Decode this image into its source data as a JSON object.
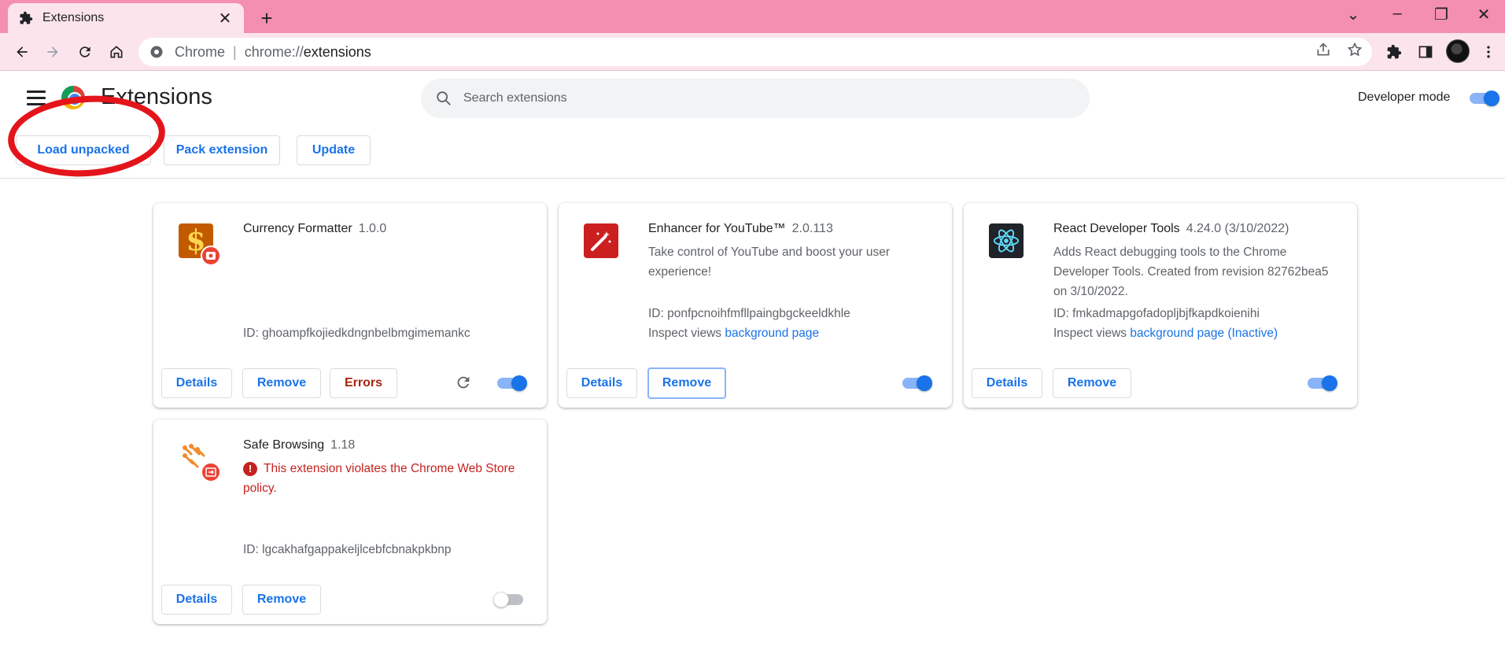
{
  "browser": {
    "tab_title": "Extensions",
    "omnibox": {
      "chip": "Chrome",
      "separator": "|",
      "url_scheme": "chrome://",
      "url_path": "extensions"
    }
  },
  "header": {
    "title": "Extensions",
    "search_placeholder": "Search extensions",
    "developer_mode_label": "Developer mode",
    "developer_mode_on": true
  },
  "actions": {
    "load_unpacked": "Load unpacked",
    "pack_extension": "Pack extension",
    "update": "Update"
  },
  "extensions": [
    {
      "name": "Currency Formatter",
      "version": "1.0.0",
      "id_text": "ID: ghoampfkojiedkdngnbelbmgimemankc",
      "enabled": true,
      "buttons": {
        "details": "Details",
        "remove": "Remove",
        "errors": "Errors"
      }
    },
    {
      "name": "Enhancer for YouTube™",
      "version": "2.0.113",
      "description": "Take control of YouTube and boost your user experience!",
      "id_text": "ID: ponfpcnoihfmfllpaingbgckeeldkhle",
      "inspect_label": "Inspect views",
      "inspect_link": "background page",
      "enabled": true,
      "buttons": {
        "details": "Details",
        "remove": "Remove"
      }
    },
    {
      "name": "React Developer Tools",
      "version": "4.24.0 (3/10/2022)",
      "description": "Adds React debugging tools to the Chrome Developer Tools. Created from revision 82762bea5 on 3/10/2022.",
      "id_text": "ID: fmkadmapgofadopljbjfkapdkoienihi",
      "inspect_label": "Inspect views",
      "inspect_link": "background page (Inactive)",
      "enabled": true,
      "buttons": {
        "details": "Details",
        "remove": "Remove"
      }
    },
    {
      "name": "Safe Browsing",
      "version": "1.18",
      "warning": "This extension violates the Chrome Web Store policy.",
      "warning_icon": "!",
      "id_text": "ID: lgcakhafgappakeljlcebfcbnakpkbnp",
      "enabled": false,
      "buttons": {
        "details": "Details",
        "remove": "Remove"
      }
    }
  ],
  "colors": {
    "tab_strip": "#f48fb1",
    "toolbar": "#fce4ec",
    "accent": "#1a73e8",
    "warning": "#c5221f",
    "annotation": "#e4141b"
  }
}
